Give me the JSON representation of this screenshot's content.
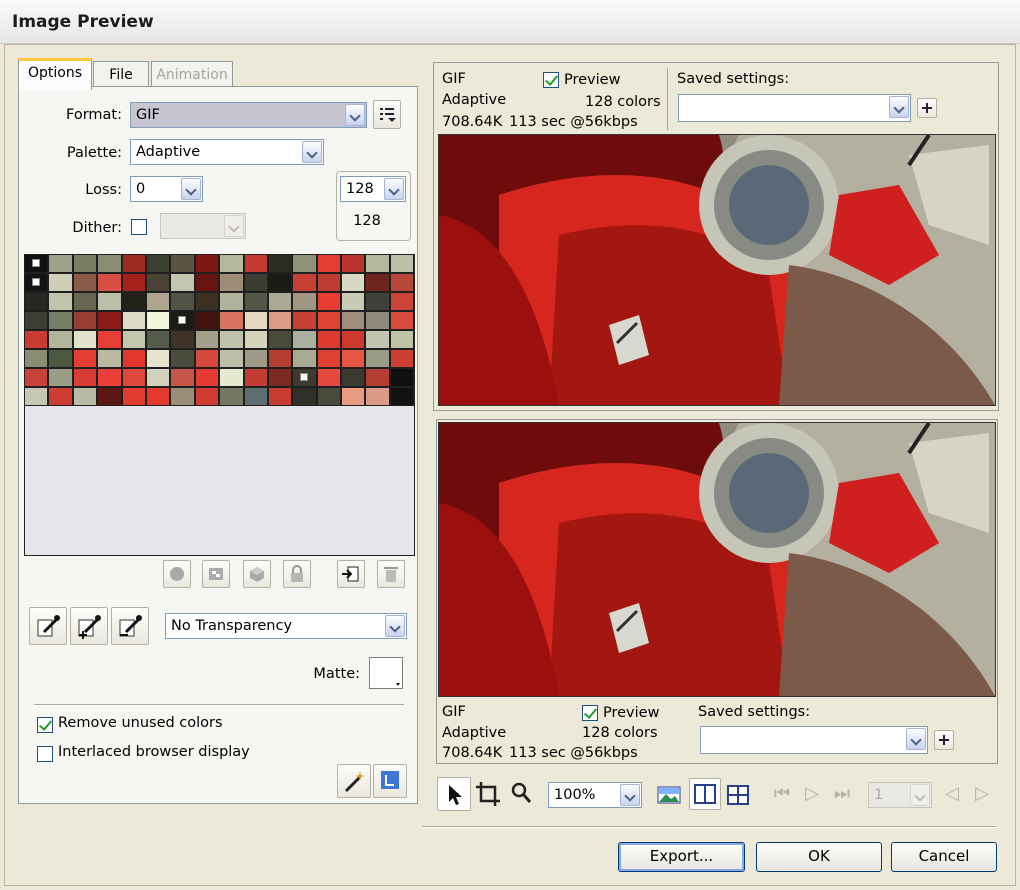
{
  "window": {
    "title": "Image Preview"
  },
  "tabs": [
    {
      "label": "Options",
      "state": "active"
    },
    {
      "label": "File",
      "state": "normal"
    },
    {
      "label": "Animation",
      "state": "disabled"
    }
  ],
  "options": {
    "format_label": "Format:",
    "format_value": "GIF",
    "palette_label": "Palette:",
    "palette_value": "Adaptive",
    "loss_label": "Loss:",
    "loss_value": "0",
    "dither_label": "Dither:",
    "dither_checked": false,
    "colors_value": "128",
    "colors_count": "128"
  },
  "palette_colors": [
    [
      "#111111",
      "#9ea185",
      "#7a7d64",
      "#8a8d72",
      "#9e2a23",
      "#3b3f30",
      "#5b5443",
      "#7f1714",
      "#b6b89e",
      "#c43a33",
      "#2b2b21",
      "#8e9277",
      "#e33d34",
      "#ba332c",
      "#b6b89e",
      "#bfc0a9"
    ],
    [
      "#141414",
      "#cfcfb9",
      "#8b5a49",
      "#d74e43",
      "#a5211c",
      "#4b4436",
      "#c4c6b0",
      "#661512",
      "#9d8d77",
      "#3a3d30",
      "#191b14",
      "#c44133",
      "#bd3d33",
      "#d7d9c4",
      "#6f251f",
      "#b74739"
    ],
    [
      "#262722",
      "#c1c3ad",
      "#666653",
      "#bdbeaa",
      "#222219",
      "#ada58f",
      "#525346",
      "#3b3024",
      "#b0b29c",
      "#525748",
      "#a9a995",
      "#9f9781",
      "#e63c31",
      "#c9cab4",
      "#3f423a",
      "#cb4438"
    ],
    [
      "#3b3e33",
      "#777e68",
      "#9c3d33",
      "#8c1b18",
      "#dcdcc6",
      "#f2f4dd",
      "#1c1c14",
      "#401210",
      "#d8735f",
      "#e7d6c2",
      "#dd9b8a",
      "#c64034",
      "#dd4435",
      "#9e8e7c",
      "#8d8b7c",
      "#d84c3e"
    ],
    [
      "#c93a30",
      "#b2b49b",
      "#e2e2cc",
      "#e73e35",
      "#c5c6ae",
      "#565c4b",
      "#3f3227",
      "#a2a08b",
      "#c0c2ac",
      "#d3d3bc",
      "#4a4a3c",
      "#aab0a0",
      "#de3a30",
      "#cd3931",
      "#c3c5b0",
      "#c0c2a6"
    ],
    [
      "#8a8d73",
      "#4a5940",
      "#e33d34",
      "#b8b99f",
      "#e2372e",
      "#e5e4ce",
      "#4b4b3e",
      "#d54a3f",
      "#bdbea7",
      "#9e9a87",
      "#b33e30",
      "#a8aa92",
      "#de4134",
      "#e85545",
      "#9a9b84",
      "#ce3f33"
    ],
    [
      "#c74339",
      "#9b9d86",
      "#d93c34",
      "#eb4039",
      "#de483c",
      "#d1d2bb",
      "#c65649",
      "#e43a31",
      "#e7e8d0",
      "#c23c33",
      "#7b2b21",
      "#3b3b2f",
      "#e64a3e",
      "#393b30",
      "#b53c33",
      "#101010"
    ],
    [
      "#c6c8b3",
      "#cf3c33",
      "#b9bba4",
      "#5c1614",
      "#e13c32",
      "#e5392f",
      "#9a8e79",
      "#d23c32",
      "#767762",
      "#5c6e70",
      "#c83b31",
      "#2e3029",
      "#4a4a3c",
      "#e79b82",
      "#da9a87",
      "#121212"
    ]
  ],
  "palette_marked": [
    "0-0",
    "1-0",
    "3-6",
    "6-11"
  ],
  "palette_tools": {
    "transparency_value": "No Transparency",
    "matte_label": "Matte:",
    "matte_color": "#ffffff"
  },
  "checks": {
    "remove_unused_label": "Remove unused colors",
    "remove_unused_checked": true,
    "interlaced_label": "Interlaced browser display",
    "interlaced_checked": false
  },
  "previews": [
    {
      "format": "GIF",
      "palette": "Adaptive",
      "size": "708.64K",
      "time": "113 sec @56kbps",
      "preview_label": "Preview",
      "preview_checked": true,
      "colors": "128 colors",
      "saved_label": "Saved settings:",
      "saved_value": ""
    },
    {
      "format": "GIF",
      "palette": "Adaptive",
      "size": "708.64K",
      "time": "113 sec @56kbps",
      "preview_label": "Preview",
      "preview_checked": true,
      "colors": "128 colors",
      "saved_label": "Saved settings:",
      "saved_value": ""
    }
  ],
  "toolbar": {
    "zoom_value": "100%",
    "frame_value": "1"
  },
  "buttons": {
    "export": "Export...",
    "ok": "OK",
    "cancel": "Cancel"
  },
  "icons": [
    "list-options-icon",
    "add-icon",
    "snap-icon",
    "web-snap-icon",
    "cube-icon",
    "lock-icon",
    "import-icon",
    "trash-icon",
    "eyedropper-icon",
    "eyedropper-add-icon",
    "eyedropper-remove-icon",
    "optimize-wizard-icon",
    "export-area-icon",
    "pointer-icon",
    "crop-icon",
    "zoom-icon",
    "background-image-icon",
    "split-two-icon",
    "split-four-icon",
    "first-frame-icon",
    "play-icon",
    "last-frame-icon",
    "prev-frame-icon",
    "next-frame-icon"
  ]
}
